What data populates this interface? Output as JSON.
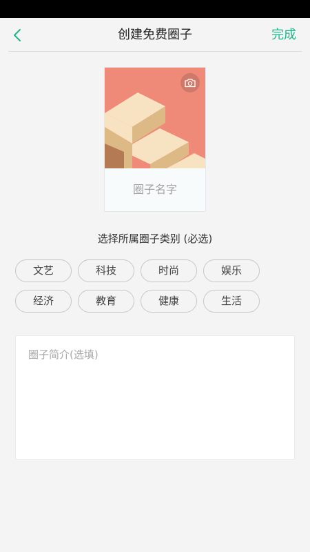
{
  "header": {
    "title": "创建免费圈子",
    "done_label": "完成",
    "back_icon": "chevron-left-icon"
  },
  "colors": {
    "accent": "#20b58c",
    "cover_background": "#ef8a78",
    "step_top": "#f7e3c2",
    "step_front": "#ddb985",
    "step_side": "#b37a53"
  },
  "cover": {
    "camera_icon": "camera-icon",
    "name_placeholder": "圈子名字"
  },
  "category": {
    "heading": "选择所属圈子类别 (必选)",
    "options": [
      "文艺",
      "科技",
      "时尚",
      "娱乐",
      "经济",
      "教育",
      "健康",
      "生活"
    ]
  },
  "intro": {
    "placeholder": "圈子简介(选填)",
    "value": ""
  }
}
